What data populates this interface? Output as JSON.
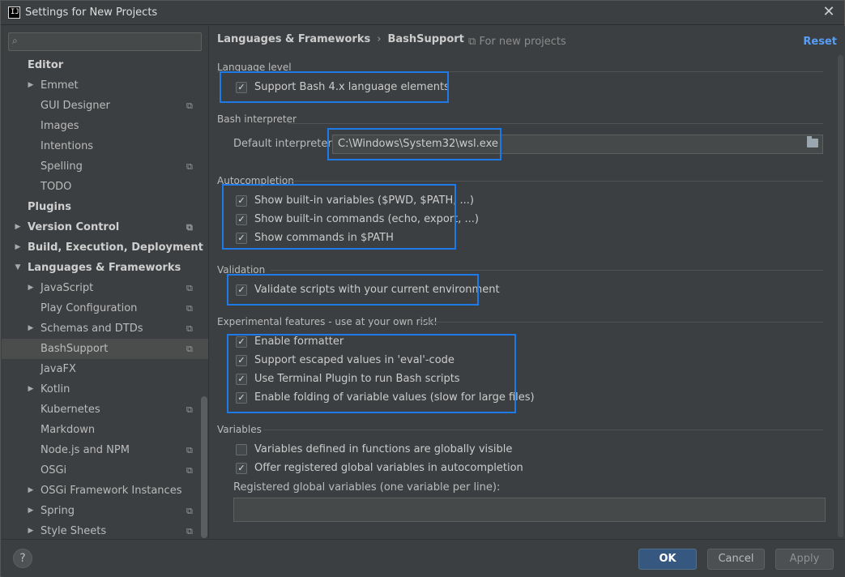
{
  "window": {
    "title": "Settings for New Projects",
    "app_icon_text": "IJ"
  },
  "search": {
    "placeholder": ""
  },
  "sidebar": {
    "items": [
      {
        "label": "Editor",
        "bold": true,
        "indent": 0,
        "arrow": "",
        "proj": false
      },
      {
        "label": "Emmet",
        "bold": false,
        "indent": 1,
        "arrow": "right",
        "proj": false
      },
      {
        "label": "GUI Designer",
        "bold": false,
        "indent": 1,
        "arrow": "",
        "proj": true
      },
      {
        "label": "Images",
        "bold": false,
        "indent": 1,
        "arrow": "",
        "proj": false
      },
      {
        "label": "Intentions",
        "bold": false,
        "indent": 1,
        "arrow": "",
        "proj": false
      },
      {
        "label": "Spelling",
        "bold": false,
        "indent": 1,
        "arrow": "",
        "proj": true
      },
      {
        "label": "TODO",
        "bold": false,
        "indent": 1,
        "arrow": "",
        "proj": false
      },
      {
        "label": "Plugins",
        "bold": true,
        "indent": 0,
        "arrow": "",
        "proj": false
      },
      {
        "label": "Version Control",
        "bold": true,
        "indent": 0,
        "arrow": "right",
        "proj": true
      },
      {
        "label": "Build, Execution, Deployment",
        "bold": true,
        "indent": 0,
        "arrow": "right",
        "proj": false
      },
      {
        "label": "Languages & Frameworks",
        "bold": true,
        "indent": 0,
        "arrow": "down",
        "proj": false
      },
      {
        "label": "JavaScript",
        "bold": false,
        "indent": 1,
        "arrow": "right",
        "proj": true
      },
      {
        "label": "Play Configuration",
        "bold": false,
        "indent": 1,
        "arrow": "",
        "proj": true
      },
      {
        "label": "Schemas and DTDs",
        "bold": false,
        "indent": 1,
        "arrow": "right",
        "proj": true
      },
      {
        "label": "BashSupport",
        "bold": false,
        "indent": 1,
        "arrow": "",
        "proj": true,
        "selected": true
      },
      {
        "label": "JavaFX",
        "bold": false,
        "indent": 1,
        "arrow": "",
        "proj": false
      },
      {
        "label": "Kotlin",
        "bold": false,
        "indent": 1,
        "arrow": "right",
        "proj": false
      },
      {
        "label": "Kubernetes",
        "bold": false,
        "indent": 1,
        "arrow": "",
        "proj": true
      },
      {
        "label": "Markdown",
        "bold": false,
        "indent": 1,
        "arrow": "",
        "proj": false
      },
      {
        "label": "Node.js and NPM",
        "bold": false,
        "indent": 1,
        "arrow": "",
        "proj": true
      },
      {
        "label": "OSGi",
        "bold": false,
        "indent": 1,
        "arrow": "",
        "proj": true
      },
      {
        "label": "OSGi Framework Instances",
        "bold": false,
        "indent": 1,
        "arrow": "right",
        "proj": false
      },
      {
        "label": "Spring",
        "bold": false,
        "indent": 1,
        "arrow": "right",
        "proj": true
      },
      {
        "label": "Style Sheets",
        "bold": false,
        "indent": 1,
        "arrow": "right",
        "proj": true
      }
    ]
  },
  "header": {
    "crumb_parent": "Languages & Frameworks",
    "crumb_separator": "›",
    "crumb_current": "BashSupport",
    "scope_note": "For new projects",
    "reset_label": "Reset"
  },
  "sections": {
    "language_level": {
      "title": "Language level",
      "options": [
        {
          "label": "Support Bash 4.x language elements",
          "checked": true
        }
      ]
    },
    "bash_interpreter": {
      "title": "Bash interpreter",
      "default_label": "Default interpreter:",
      "default_value": "C:\\Windows\\System32\\wsl.exe"
    },
    "autocompletion": {
      "title": "Autocompletion",
      "options": [
        {
          "label": "Show built-in variables ($PWD, $PATH, ...)",
          "checked": true
        },
        {
          "label": "Show built-in commands (echo, export, ...)",
          "checked": true
        },
        {
          "label": "Show commands in $PATH",
          "checked": true
        }
      ]
    },
    "validation": {
      "title": "Validation",
      "options": [
        {
          "label": "Validate scripts with your current environment",
          "checked": true
        }
      ]
    },
    "experimental": {
      "title": "Experimental features - use at your own risk!",
      "options": [
        {
          "label": "Enable formatter",
          "checked": true
        },
        {
          "label": "Support escaped values in 'eval'-code",
          "checked": true
        },
        {
          "label": "Use Terminal Plugin to run Bash scripts",
          "checked": true
        },
        {
          "label": "Enable folding of variable values (slow for large files)",
          "checked": true
        }
      ]
    },
    "variables": {
      "title": "Variables",
      "options": [
        {
          "label": "Variables defined in functions are globally visible",
          "checked": false
        },
        {
          "label": "Offer registered global variables in autocompletion",
          "checked": true
        }
      ],
      "registered_label": "Registered global variables (one variable per line):",
      "registered_value": ""
    }
  },
  "footer": {
    "help_label": "?",
    "ok_label": "OK",
    "cancel_label": "Cancel",
    "apply_label": "Apply"
  },
  "colors": {
    "accent": "#1e7ae6",
    "link": "#589df6",
    "ok_button": "#365880",
    "background": "#3c3f41"
  }
}
